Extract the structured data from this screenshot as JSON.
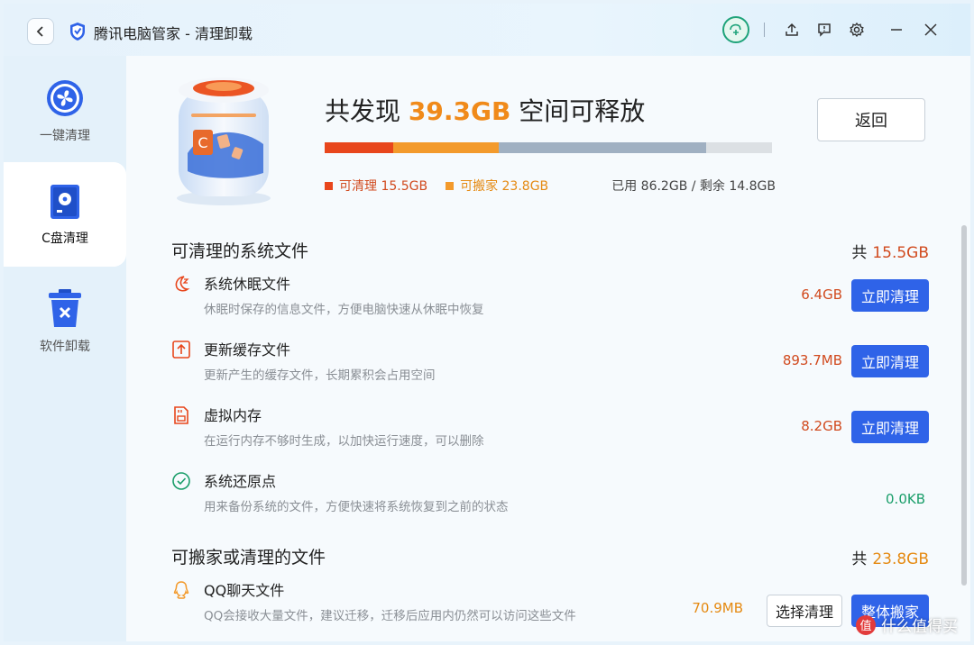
{
  "window": {
    "title": "腾讯电脑管家 - 清理卸载",
    "icons": [
      "back-icon",
      "shield-logo-icon",
      "avatar-icon",
      "upload-icon",
      "feedback-icon",
      "settings-icon",
      "minimize-icon",
      "close-icon"
    ]
  },
  "sidebar": {
    "items": [
      {
        "label": "一键清理",
        "icon": "fan-icon",
        "active": false
      },
      {
        "label": "C盘清理",
        "icon": "disk-icon",
        "active": true
      },
      {
        "label": "软件卸载",
        "icon": "trash-icon",
        "active": false
      }
    ]
  },
  "summary": {
    "prefix": "共发现",
    "amount": "39.3GB",
    "suffix": "空间可释放",
    "return_label": "返回",
    "legend_clean": "可清理 15.5GB",
    "legend_move": "可搬家 23.8GB",
    "usage": "已用 86.2GB / 剩余 14.8GB",
    "bar": {
      "clean_gb": 15.5,
      "move_gb": 23.8,
      "used_gb": 86.2,
      "free_gb": 14.8,
      "colors": {
        "clean": "#e8461c",
        "move": "#f39a2c",
        "used": "#a0b0c2",
        "free": "#dce0e4"
      }
    }
  },
  "section1": {
    "title": "可清理的系统文件",
    "total_prefix": "共",
    "total_value": "15.5GB",
    "total_color": "#d14a1e",
    "rows": [
      {
        "name": "系统休眠文件",
        "desc": "休眠时保存的信息文件，方便电脑快速从休眠中恢复",
        "size": "6.4GB",
        "size_color": "#d14a1e",
        "button": "立即清理",
        "icon": "moon-icon"
      },
      {
        "name": "更新缓存文件",
        "desc": "更新产生的缓存文件，长期累积会占用空间",
        "size": "893.7MB",
        "size_color": "#d14a1e",
        "button": "立即清理",
        "icon": "update-icon"
      },
      {
        "name": "虚拟内存",
        "desc": "在运行内存不够时生成，以加快运行速度，可以删除",
        "size": "8.2GB",
        "size_color": "#d14a1e",
        "button": "立即清理",
        "icon": "memory-icon"
      },
      {
        "name": "系统还原点",
        "desc": "用来备份系统的文件，方便快速将系统恢复到之前的状态",
        "size": "0.0KB",
        "size_color": "#1a9e6a",
        "icon": "check-circle-icon"
      }
    ]
  },
  "section2": {
    "title": "可搬家或清理的文件",
    "total_prefix": "共",
    "total_value": "23.8GB",
    "total_color": "#e58a12",
    "rows": [
      {
        "name": "QQ聊天文件",
        "desc": "QQ会接收大量文件，建议迁移，迁移后应用内仍然可以访问这些文件",
        "size": "70.9MB",
        "size_color": "#e58a12",
        "button_secondary": "选择清理",
        "button": "整体搬家",
        "icon": "qq-icon"
      }
    ]
  },
  "watermark": {
    "badge": "值",
    "text": "什么值得买"
  }
}
